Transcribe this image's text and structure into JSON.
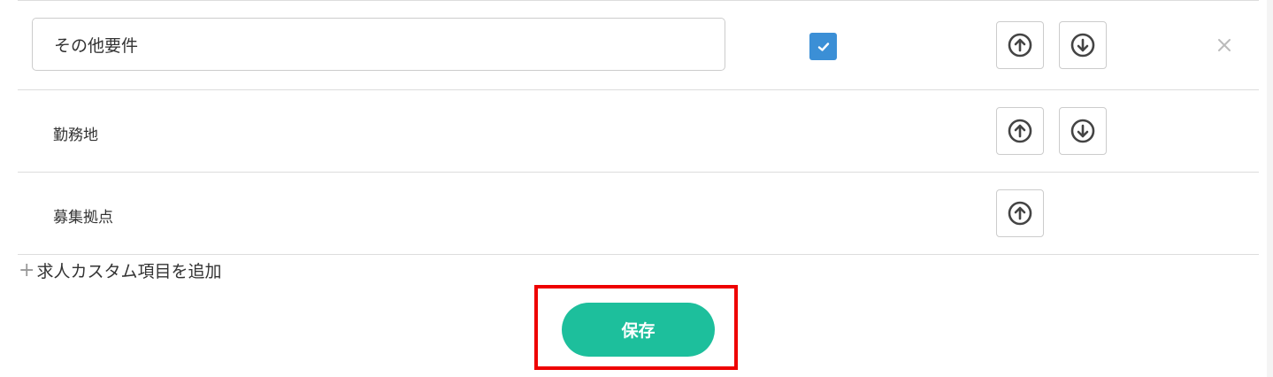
{
  "rows": [
    {
      "label": "その他要件",
      "editable": true,
      "checked": true,
      "buttons": [
        "arrow-up-circle-icon",
        "arrow-down-circle-icon"
      ],
      "deletable": true
    },
    {
      "label": "勤務地",
      "buttons": [
        "arrow-up-circle-icon",
        "arrow-down-circle-icon"
      ]
    },
    {
      "label": "募集拠点",
      "buttons": [
        "arrow-up-circle-icon"
      ]
    }
  ],
  "add_link": {
    "plus": "+",
    "label": "求人カスタム項目を追加"
  },
  "save_button": {
    "label": "保存"
  },
  "colors": {
    "accent_green": "#1dbf9c",
    "checkbox_blue": "#3b8fd6",
    "highlight_red": "#ee0000",
    "border_gray": "#dddddd"
  }
}
